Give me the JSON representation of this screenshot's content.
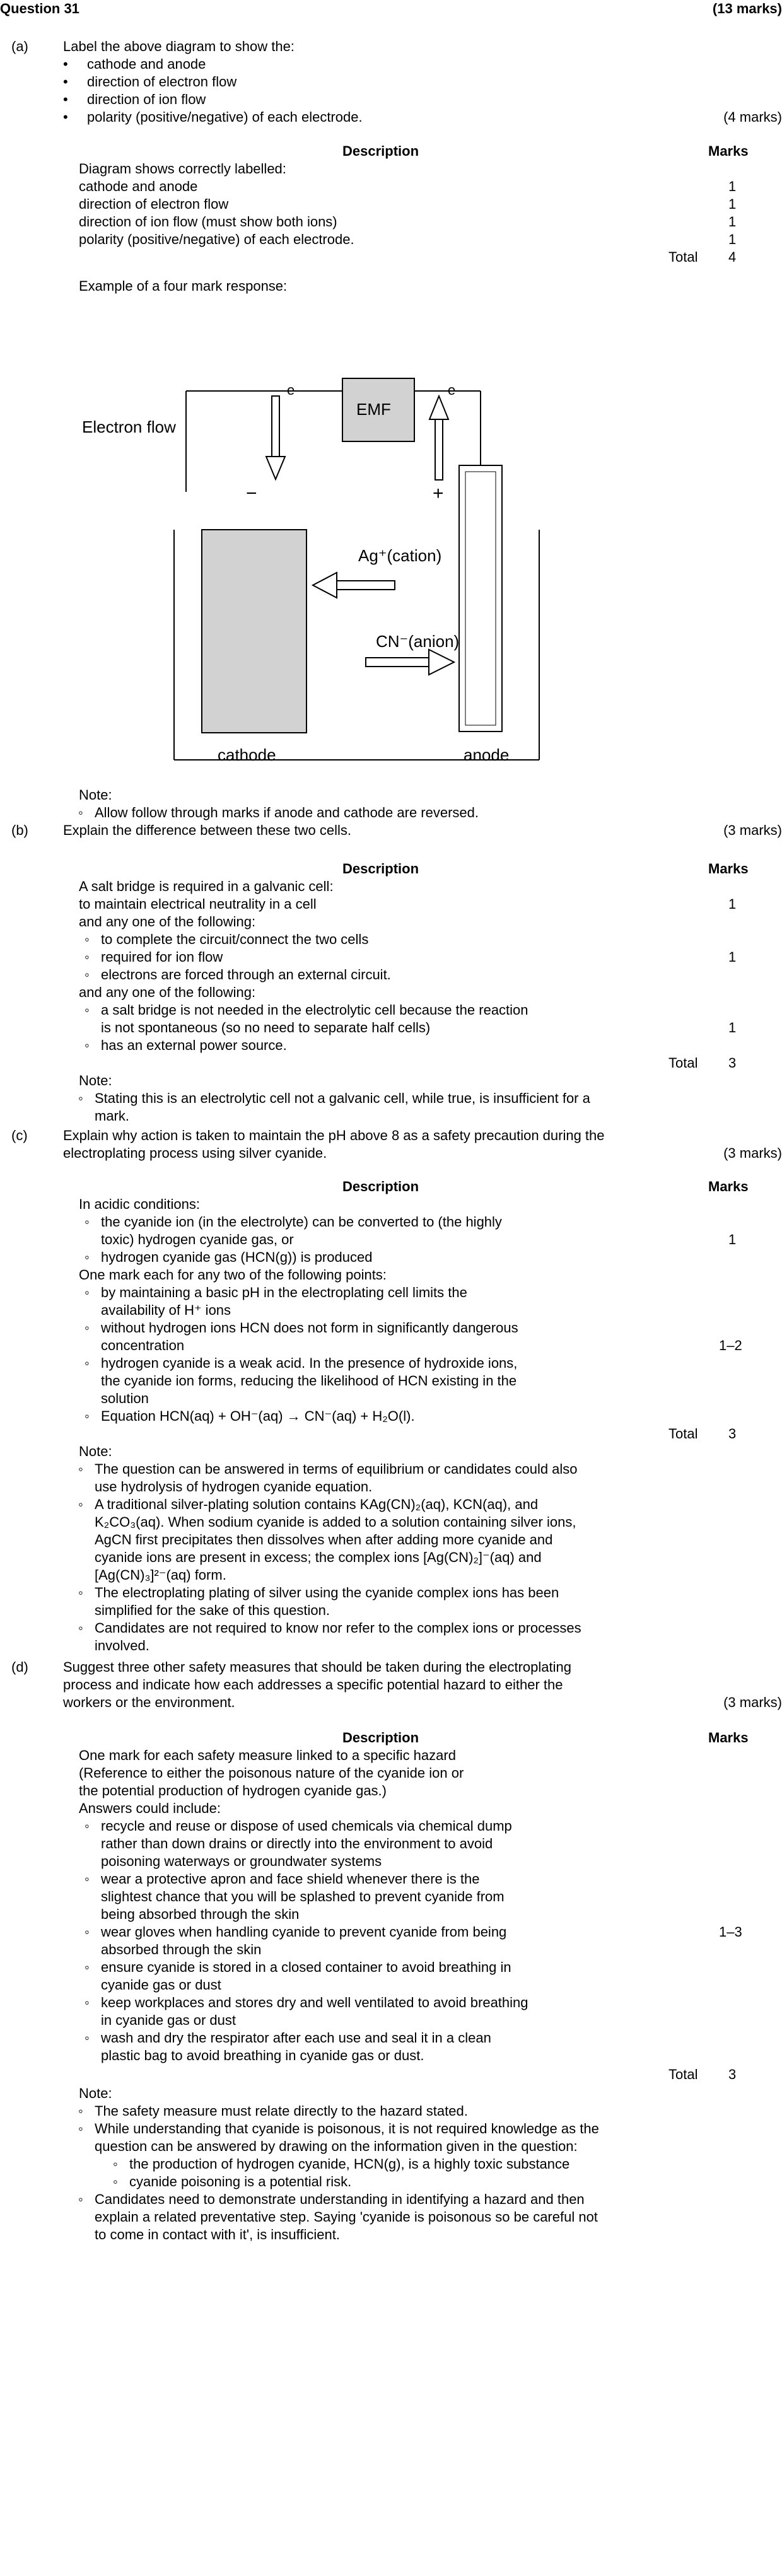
{
  "header": {
    "title": "Question 31",
    "marks": "(13 marks)"
  },
  "parts": {
    "a": {
      "letter": "(a)",
      "intro": "Label the above diagram to show the:",
      "items": [
        "cathode and anode",
        "direction of electron flow",
        "direction of ion flow",
        "polarity (positive/negative) of each electrode."
      ],
      "marks": "(4 marks)",
      "table": {
        "desc_head": "Description",
        "marks_head": "Marks",
        "lines": [
          "Diagram shows correctly labelled:",
          "cathode and anode",
          "direction of electron flow",
          "direction of ion flow (must show both ions)",
          "polarity (positive/negative) of each electrode."
        ],
        "values": [
          "1",
          "1",
          "1",
          "1"
        ],
        "total_label": "Total",
        "total": "4"
      },
      "example": "Example of a four mark response:",
      "diagram": {
        "electron_flow": "Electron flow",
        "e_left": "e",
        "e_right": "e",
        "emf": "EMF",
        "minus": "−",
        "plus": "+",
        "ag": "Ag⁺(cation)",
        "cn": "CN⁻(anion)",
        "cathode": "cathode",
        "anode": "anode"
      },
      "note_label": "Note:",
      "notes": [
        "Allow follow through marks if anode and cathode are reversed."
      ]
    },
    "b": {
      "letter": "(b)",
      "question": "Explain the difference between these two cells.",
      "marks": "(3 marks)",
      "desc_head": "Description",
      "marks_head": "Marks",
      "lines": [
        "A salt bridge is required in a galvanic cell:",
        "to maintain electrical neutrality in a cell",
        "and any one of the following:",
        "to complete the circuit/connect the two cells",
        "required for ion flow",
        "electrons are forced through an external circuit.",
        "and any one of the following:",
        "a salt bridge is not needed in the electrolytic cell because the reaction",
        "is not spontaneous (so no need to separate half cells)",
        "has an external power source."
      ],
      "values": [
        "1",
        "1",
        "1"
      ],
      "total_label": "Total",
      "total": "3",
      "note_label": "Note:",
      "notes": [
        "Stating this is an electrolytic cell not a galvanic cell, while true, is insufficient for a",
        "mark."
      ]
    },
    "c": {
      "letter": "(c)",
      "question": [
        "Explain why action is taken to maintain the pH above 8 as a safety precaution during the",
        "electroplating process using silver cyanide."
      ],
      "marks": "(3 marks)",
      "desc_head": "Description",
      "marks_head": "Marks",
      "lines": [
        "In acidic conditions:",
        "the cyanide ion (in the electrolyte) can be converted to (the highly",
        "toxic) hydrogen cyanide gas, or",
        "hydrogen cyanide gas (HCN(g)) is produced",
        "One mark each for any two of the following points:",
        "by maintaining a basic pH in the electroplating cell limits the",
        "availability of H⁺ ions",
        "without hydrogen ions HCN does not form in significantly dangerous",
        "concentration",
        "hydrogen cyanide is a weak acid. In the presence of hydroxide ions,",
        "the cyanide ion forms, reducing the likelihood of HCN existing in the",
        "solution",
        "Equation   HCN(aq) + OH⁻(aq)   →   CN⁻(aq) + H₂O(l)."
      ],
      "values": [
        "1",
        "1–2"
      ],
      "total_label": "Total",
      "total": "3",
      "note_label": "Note:",
      "notes": [
        "The question can be answered in terms of equilibrium or candidates could also",
        "use hydrolysis of hydrogen cyanide equation.",
        "A traditional silver-plating solution contains KAg(CN)₂(aq), KCN(aq), and",
        "K₂CO₃(aq). When sodium cyanide is added to a solution containing silver ions,",
        "AgCN first precipitates then dissolves when after adding more cyanide and",
        "cyanide ions are present in excess; the complex ions [Ag(CN)₂]⁻(aq) and",
        "[Ag(CN)₃]²⁻(aq) form.",
        "The electroplating plating of silver using the cyanide complex ions has been",
        "simplified for the sake of this question.",
        "Candidates are not required to know nor refer to the complex ions or processes",
        "involved."
      ]
    },
    "d": {
      "letter": "(d)",
      "question": [
        "Suggest three other safety measures that should be taken during the electroplating",
        "process and indicate how each addresses a specific potential hazard to either the",
        "workers or the environment."
      ],
      "marks": "(3 marks)",
      "desc_head": "Description",
      "marks_head": "Marks",
      "lines": [
        "One mark for each safety measure linked to a specific hazard",
        "(Reference to either the poisonous nature of the cyanide ion or",
        "the potential production of hydrogen cyanide gas.)",
        "Answers could include:",
        "recycle and reuse or dispose of used chemicals via chemical dump",
        "rather than down drains or directly into the environment to avoid",
        "poisoning waterways or groundwater systems",
        "wear a protective apron and face shield whenever there is the",
        "slightest chance that you will be splashed to prevent cyanide from",
        "being absorbed through the skin",
        "wear gloves when handling cyanide to prevent cyanide from being",
        "absorbed through the skin",
        "ensure cyanide is stored in a closed container to avoid breathing in",
        "cyanide gas or dust",
        "keep workplaces and stores dry and well ventilated to avoid breathing",
        "in cyanide gas or dust",
        "wash and dry the respirator after each use and seal it in a clean",
        "plastic bag to avoid breathing in cyanide gas or dust."
      ],
      "values": [
        "1–3"
      ],
      "total_label": "Total",
      "total": "3",
      "note_label": "Note:",
      "notes": [
        "The safety measure must relate directly to the hazard stated.",
        "While understanding that cyanide is poisonous, it is not required knowledge as the",
        "question can be answered by drawing on the information given in the question:",
        "the production of hydrogen cyanide, HCN(g), is a highly toxic substance",
        "cyanide poisoning is a potential risk.",
        "Candidates need to demonstrate understanding in identifying a hazard and then",
        "explain a related preventative step. Saying 'cyanide is poisonous so be careful not",
        "to come in contact with it', is insufficient."
      ]
    }
  }
}
